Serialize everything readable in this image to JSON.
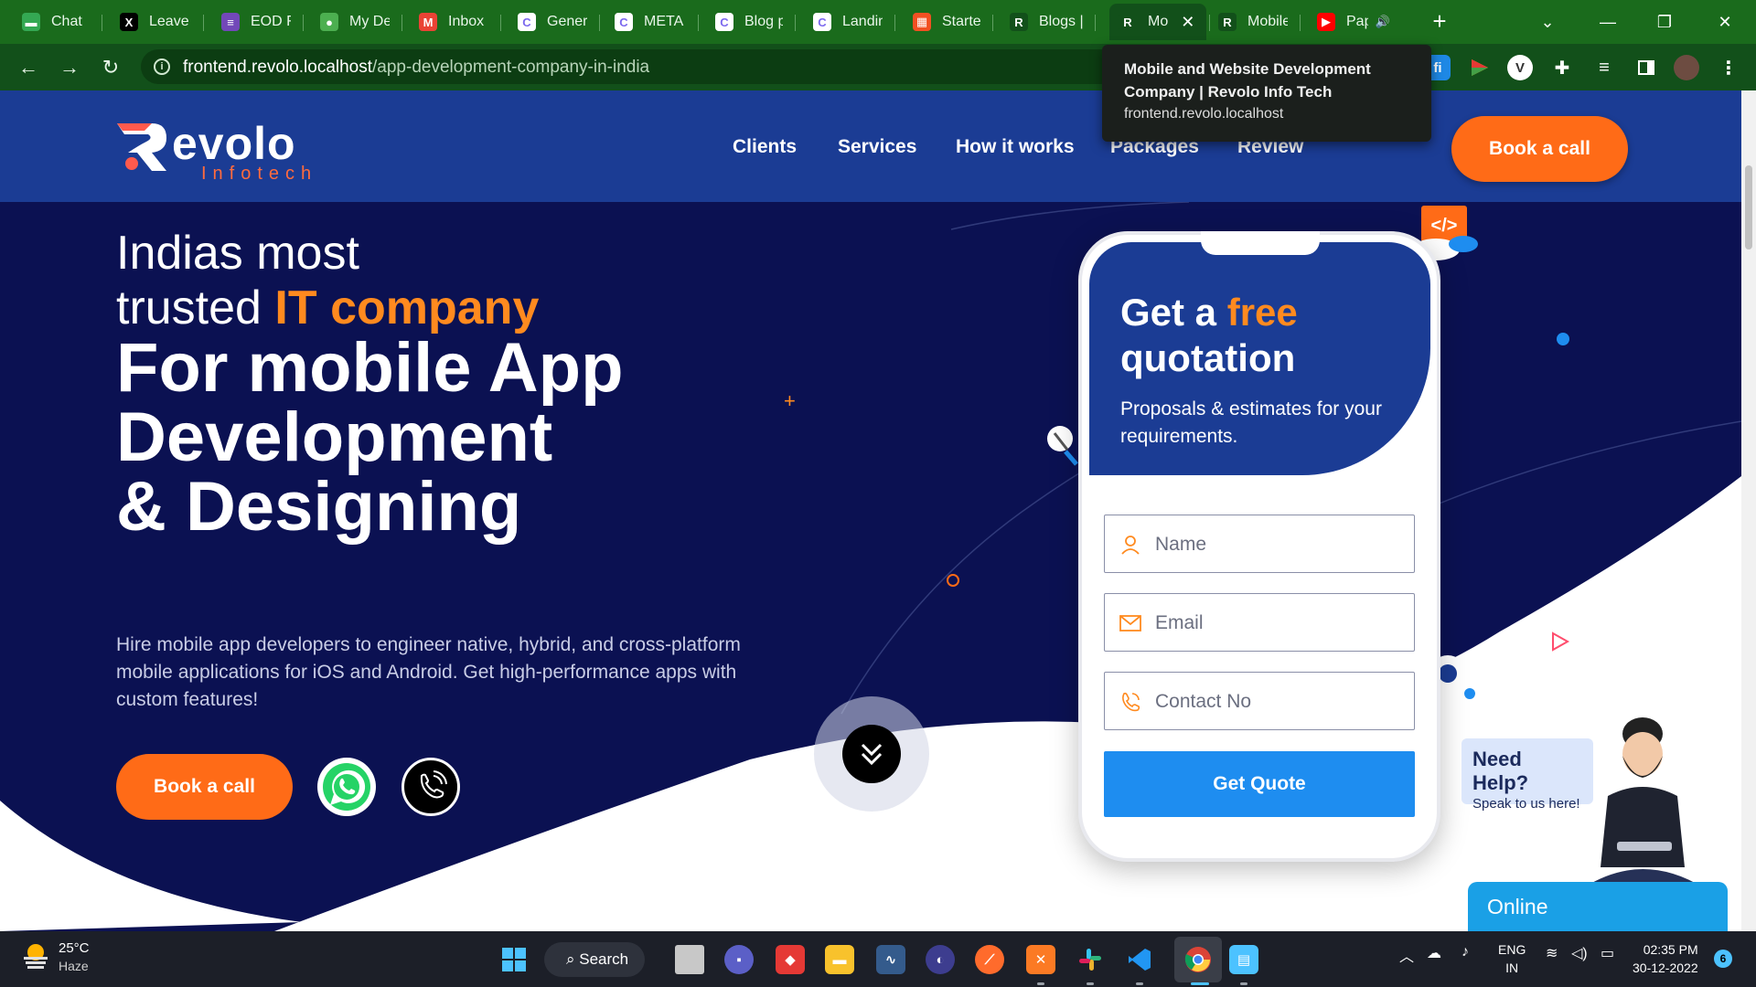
{
  "browser": {
    "tabs": [
      {
        "label": "Chat",
        "icon": "google-chat-icon",
        "color": "#34a853",
        "glyph": "▬"
      },
      {
        "label": "Leave &",
        "icon": "x-logo-icon",
        "color": "#000000",
        "glyph": "X"
      },
      {
        "label": "EOD Fo",
        "icon": "forms-icon",
        "color": "#7248b9",
        "glyph": "≡"
      },
      {
        "label": "My Des",
        "icon": "globe-icon",
        "color": "#4caf50",
        "glyph": "●"
      },
      {
        "label": "Inbox (",
        "icon": "gmail-icon",
        "color": "#ea4335",
        "glyph": "M"
      },
      {
        "label": "General",
        "icon": "clickup-icon",
        "color": "#ffffff",
        "glyph": "C"
      },
      {
        "label": "META a",
        "icon": "clickup-icon",
        "color": "#ffffff",
        "glyph": "C"
      },
      {
        "label": "Blog pa",
        "icon": "clickup-icon",
        "color": "#ffffff",
        "glyph": "C"
      },
      {
        "label": "Landing",
        "icon": "clickup-icon",
        "color": "#ffffff",
        "glyph": "C"
      },
      {
        "label": "Starter",
        "icon": "windows-grid-icon",
        "color": "#f25022",
        "glyph": "▦"
      },
      {
        "label": "Blogs |",
        "icon": "revolo-icon",
        "color": "#12501a",
        "glyph": "R"
      },
      {
        "label": "Mo",
        "icon": "revolo-icon",
        "color": "#12501a",
        "glyph": "R",
        "active": true
      },
      {
        "label": "Mobile",
        "icon": "revolo-icon",
        "color": "#12501a",
        "glyph": "R"
      },
      {
        "label": "Pap",
        "icon": "youtube-icon",
        "color": "#ff0000",
        "glyph": "▶"
      }
    ],
    "url_domain": "frontend.revolo.localhost",
    "url_path": "/app-development-company-in-india",
    "tooltip": {
      "title": "Mobile and Website Development Company | Revolo Info Tech",
      "url": "frontend.revolo.localhost"
    }
  },
  "site": {
    "logo": {
      "word": "evolo",
      "sub": "Infotech"
    },
    "nav": [
      "Clients",
      "Services",
      "How it works",
      "Packages",
      "Review"
    ],
    "header_cta": "Book a call",
    "hero": {
      "line1": "Indias most",
      "line2_plain": "trusted ",
      "line2_accent": "IT company",
      "big1": "For mobile App",
      "big2": "Development",
      "big3": "& Designing",
      "description": "Hire mobile app developers to engineer native, hybrid, and cross-platform mobile applications for iOS and Android. Get high-performance apps with custom features!",
      "cta": "Book a call"
    },
    "quote": {
      "title_prefix": "Get a ",
      "title_accent": "free",
      "title_line2": "quotation",
      "subtitle": "Proposals & estimates for your requirements.",
      "name_placeholder": "Name",
      "email_placeholder": "Email",
      "contact_placeholder": "Contact No",
      "submit": "Get Quote"
    },
    "chat": {
      "help_title": "Need Help?",
      "help_sub": "Speak to us here!",
      "status": "Online"
    }
  },
  "taskbar": {
    "weather_temp": "25°C",
    "weather_cond": "Haze",
    "search_label": "Search",
    "lang_line1": "ENG",
    "lang_line2": "IN",
    "time": "02:35 PM",
    "date": "30-12-2022",
    "notifications": "6"
  },
  "colors": {
    "header_blue": "#1b3c94",
    "hero_navy": "#0b1152",
    "brand_orange": "#ff6b17",
    "accent_orange": "#ff8a1f",
    "cta_blue": "#1e8df0"
  }
}
